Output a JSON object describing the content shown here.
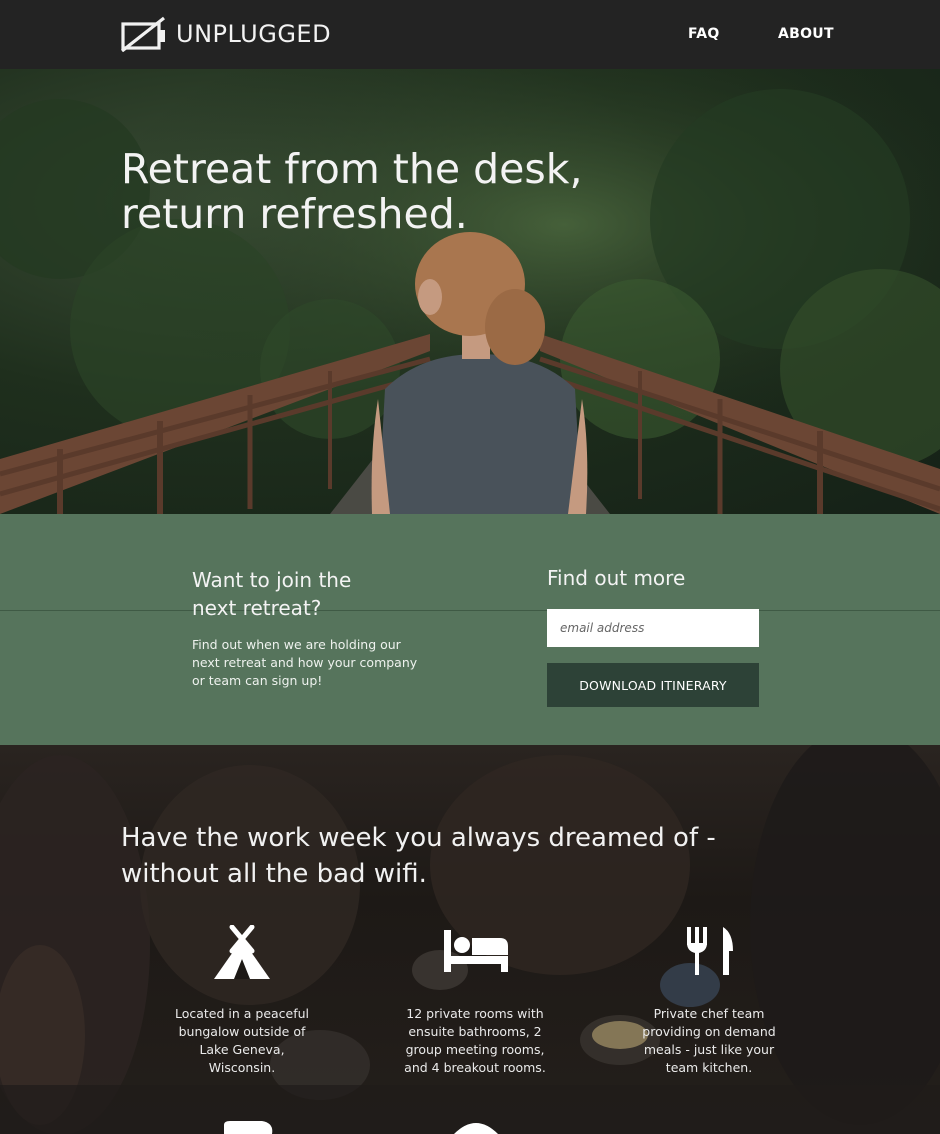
{
  "nav": {
    "brand": "UNPLUGGED",
    "links": [
      "FAQ",
      "ABOUT"
    ]
  },
  "hero": {
    "title_line1": "Retreat from the desk,",
    "title_line2": "return refreshed."
  },
  "signup": {
    "join_title_line1": "Want to join the",
    "join_title_line2": "next retreat?",
    "join_text": "Find out when we are holding our next retreat and how your company or team can sign up!",
    "find_title": "Find out more",
    "email_placeholder": "email address",
    "download_label": "DOWNLOAD ITINERARY"
  },
  "features": {
    "title_line1": "Have the work week you always dreamed of -",
    "title_line2": "without all the bad wifi.",
    "items": [
      {
        "icon": "tent-icon",
        "text": "Located in a peaceful bungalow outside of Lake Geneva, Wisconsin."
      },
      {
        "icon": "bed-icon",
        "text": "12 private rooms with ensuite bathrooms, 2 group meeting rooms, and 4 breakout rooms."
      },
      {
        "icon": "utensils-icon",
        "text": "Private chef team providing on demand meals - just like your team kitchen."
      }
    ]
  },
  "colors": {
    "nav_bg": "#232323",
    "band_bg": "#56745c",
    "button_bg": "#2d4237"
  }
}
